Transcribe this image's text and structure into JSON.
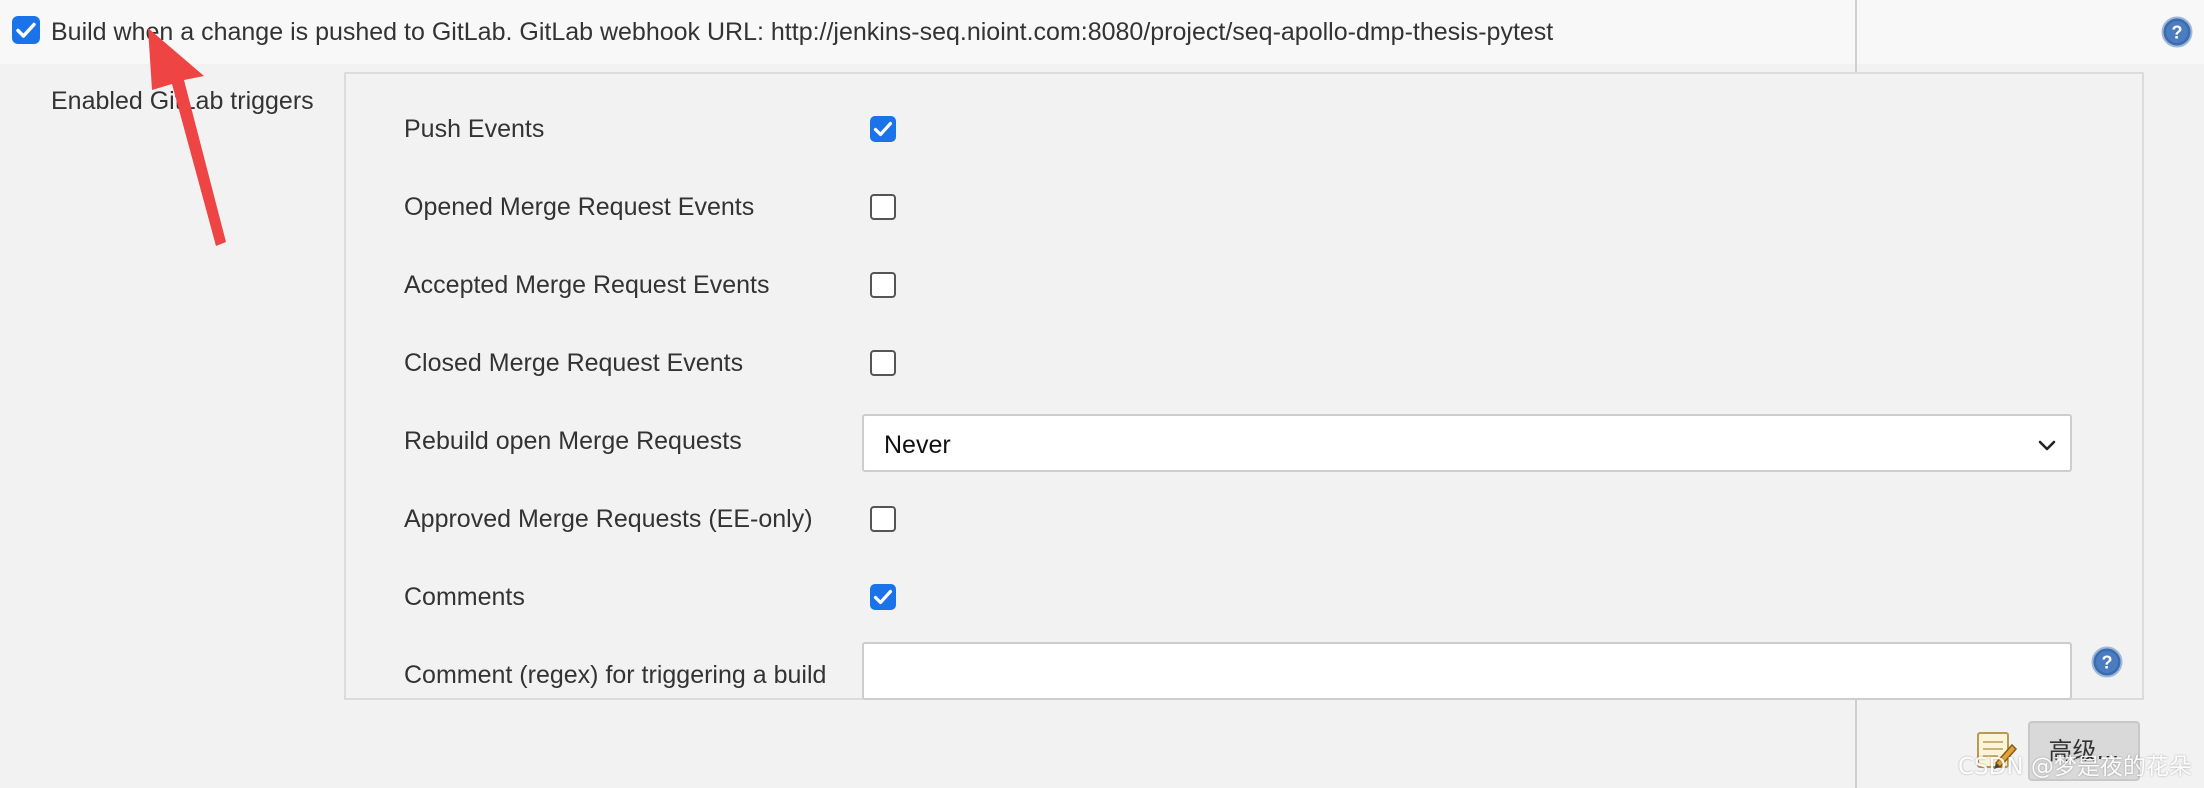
{
  "header": {
    "build_trigger_checked": true,
    "build_trigger_label": "Build when a change is pushed to GitLab. GitLab webhook URL: http://jenkins-seq.nioint.com:8080/project/seq-apollo-dmp-thesis-pytest"
  },
  "triggers": {
    "section_label": "Enabled GitLab triggers",
    "push_events": {
      "label": "Push Events",
      "checked": true
    },
    "opened_mr_events": {
      "label": "Opened Merge Request Events",
      "checked": false
    },
    "accepted_mr_events": {
      "label": "Accepted Merge Request Events",
      "checked": false
    },
    "closed_mr_events": {
      "label": "Closed Merge Request Events",
      "checked": false
    },
    "rebuild_open_mr": {
      "label": "Rebuild open Merge Requests",
      "value": "Never"
    },
    "approved_mr": {
      "label": "Approved Merge Requests (EE-only)",
      "checked": false
    },
    "comments": {
      "label": "Comments",
      "checked": true
    },
    "comment_regex": {
      "label": "Comment (regex) for triggering a build",
      "value": ""
    }
  },
  "footer": {
    "advanced_button": "高级...",
    "watermark": "CSDN @梦是夜的花朵"
  },
  "colors": {
    "accent": "#1a73e8",
    "help_blue": "#3d6cae",
    "annotation_arrow": "#ef4444"
  }
}
